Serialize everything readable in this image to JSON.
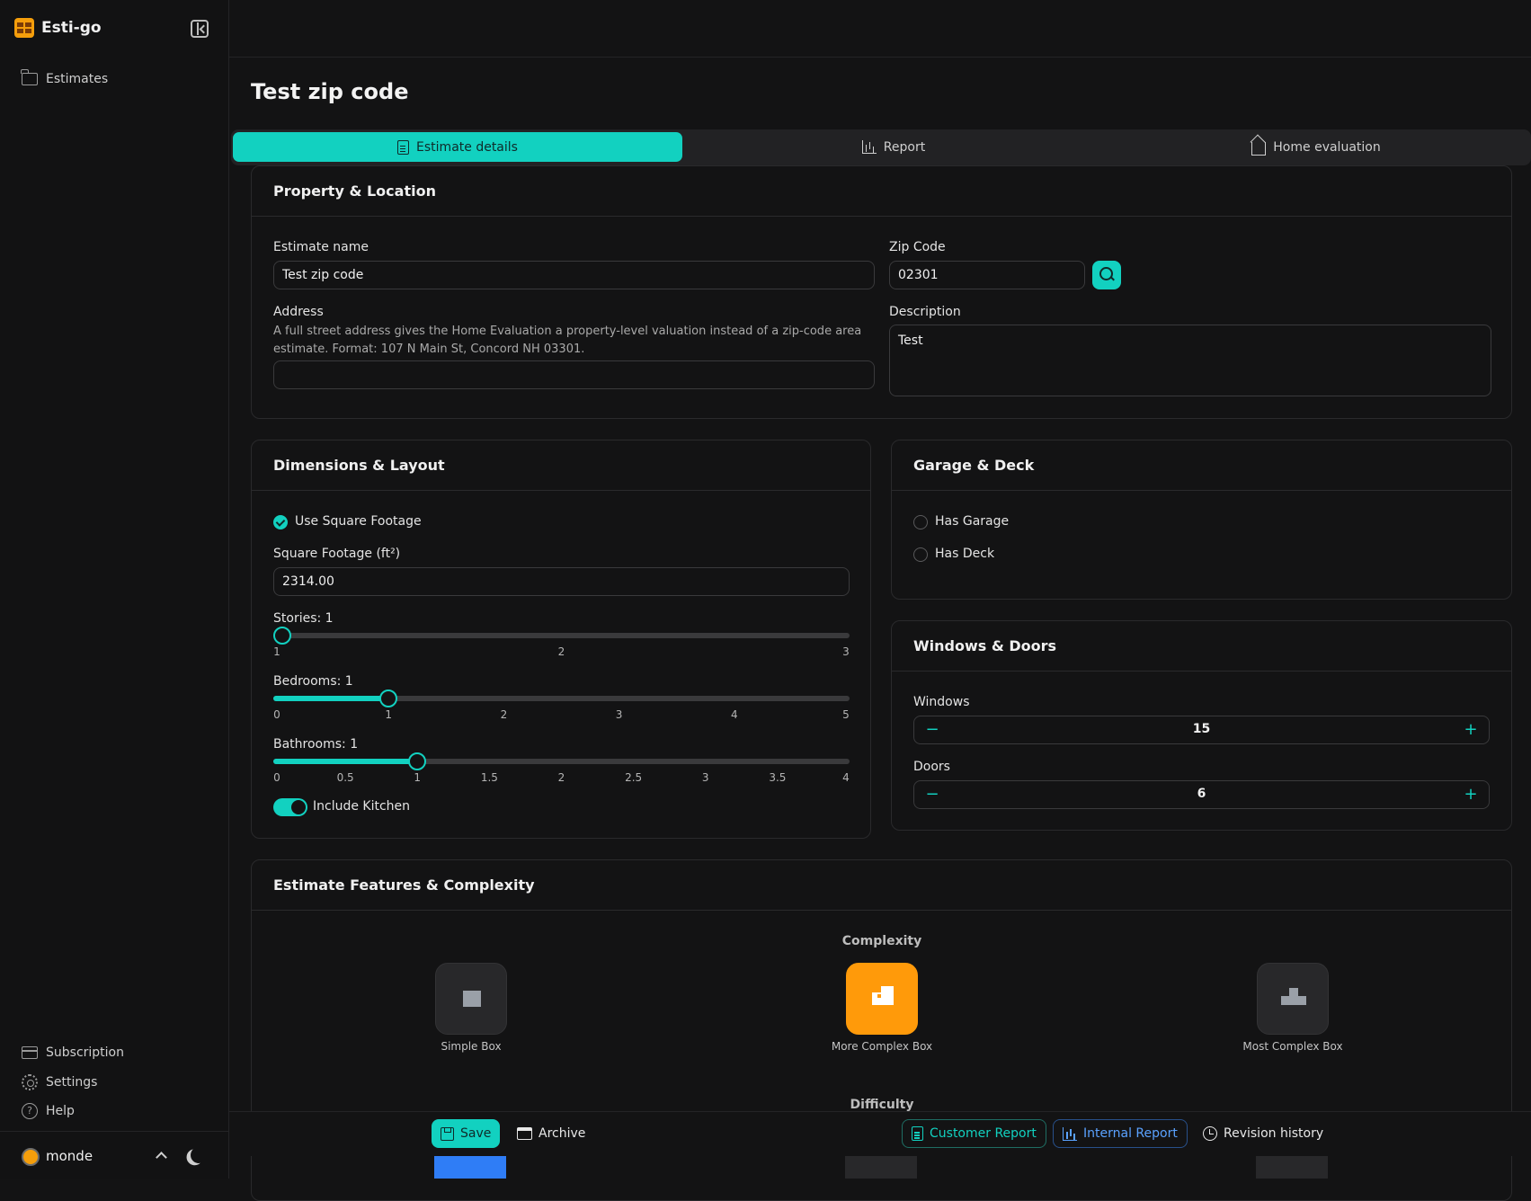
{
  "app": {
    "name": "Esti-go",
    "nav": {
      "estimates": "Estimates"
    },
    "footer_nav": {
      "subscription": "Subscription",
      "settings": "Settings",
      "help": "Help"
    },
    "user": {
      "name": "monde"
    }
  },
  "page": {
    "title": "Test zip code"
  },
  "tabs": [
    {
      "label": "Estimate details",
      "icon": "document-icon",
      "active": true
    },
    {
      "label": "Report",
      "icon": "bar-chart-icon",
      "active": false
    },
    {
      "label": "Home evaluation",
      "icon": "home-icon",
      "active": false
    }
  ],
  "property": {
    "title": "Property & Location",
    "estimate_name_label": "Estimate name",
    "estimate_name_value": "Test zip code",
    "zip_label": "Zip Code",
    "zip_value": "02301",
    "address_label": "Address",
    "address_help": "A full street address gives the Home Evaluation a property-level valuation instead of a zip-code area estimate. Format: 107 N Main St, Concord NH 03301.",
    "address_value": "",
    "description_label": "Description",
    "description_value": "Test"
  },
  "dimensions": {
    "title": "Dimensions & Layout",
    "use_sqft_label": "Use Square Footage",
    "sqft_label": "Square Footage (ft²)",
    "sqft_value": "2314.00",
    "stories": {
      "label": "Stories: 1",
      "value": 1,
      "min": 1,
      "max": 3,
      "ticks": [
        "1",
        "2",
        "3"
      ]
    },
    "bedrooms": {
      "label": "Bedrooms: 1",
      "value": 1,
      "min": 0,
      "max": 5,
      "ticks": [
        "0",
        "1",
        "2",
        "3",
        "4",
        "5"
      ]
    },
    "bathrooms": {
      "label": "Bathrooms: 1",
      "value": 1,
      "min": 0,
      "max": 4,
      "ticks": [
        "0",
        "0.5",
        "1",
        "1.5",
        "2",
        "2.5",
        "3",
        "3.5",
        "4"
      ]
    },
    "kitchen_label": "Include Kitchen"
  },
  "garage": {
    "title": "Garage & Deck",
    "has_garage": "Has Garage",
    "has_deck": "Has Deck"
  },
  "windows": {
    "title": "Windows & Doors",
    "windows_label": "Windows",
    "windows_value": "15",
    "doors_label": "Doors",
    "doors_value": "6",
    "minus": "−",
    "plus": "+"
  },
  "features": {
    "title": "Estimate Features & Complexity",
    "complexity_caption": "Complexity",
    "options": [
      {
        "label": "Simple Box",
        "selected": false
      },
      {
        "label": "More Complex Box",
        "selected": true
      },
      {
        "label": "Most Complex Box",
        "selected": false
      }
    ],
    "difficulty_caption": "Difficulty"
  },
  "actions": {
    "save": "Save",
    "archive": "Archive",
    "customer_report": "Customer Report",
    "internal_report": "Internal Report",
    "revision_history": "Revision history"
  },
  "colors": {
    "accent": "#12d1c0",
    "selected_tile": "#ff9a0a",
    "internal_report": "#5aa2ff"
  }
}
